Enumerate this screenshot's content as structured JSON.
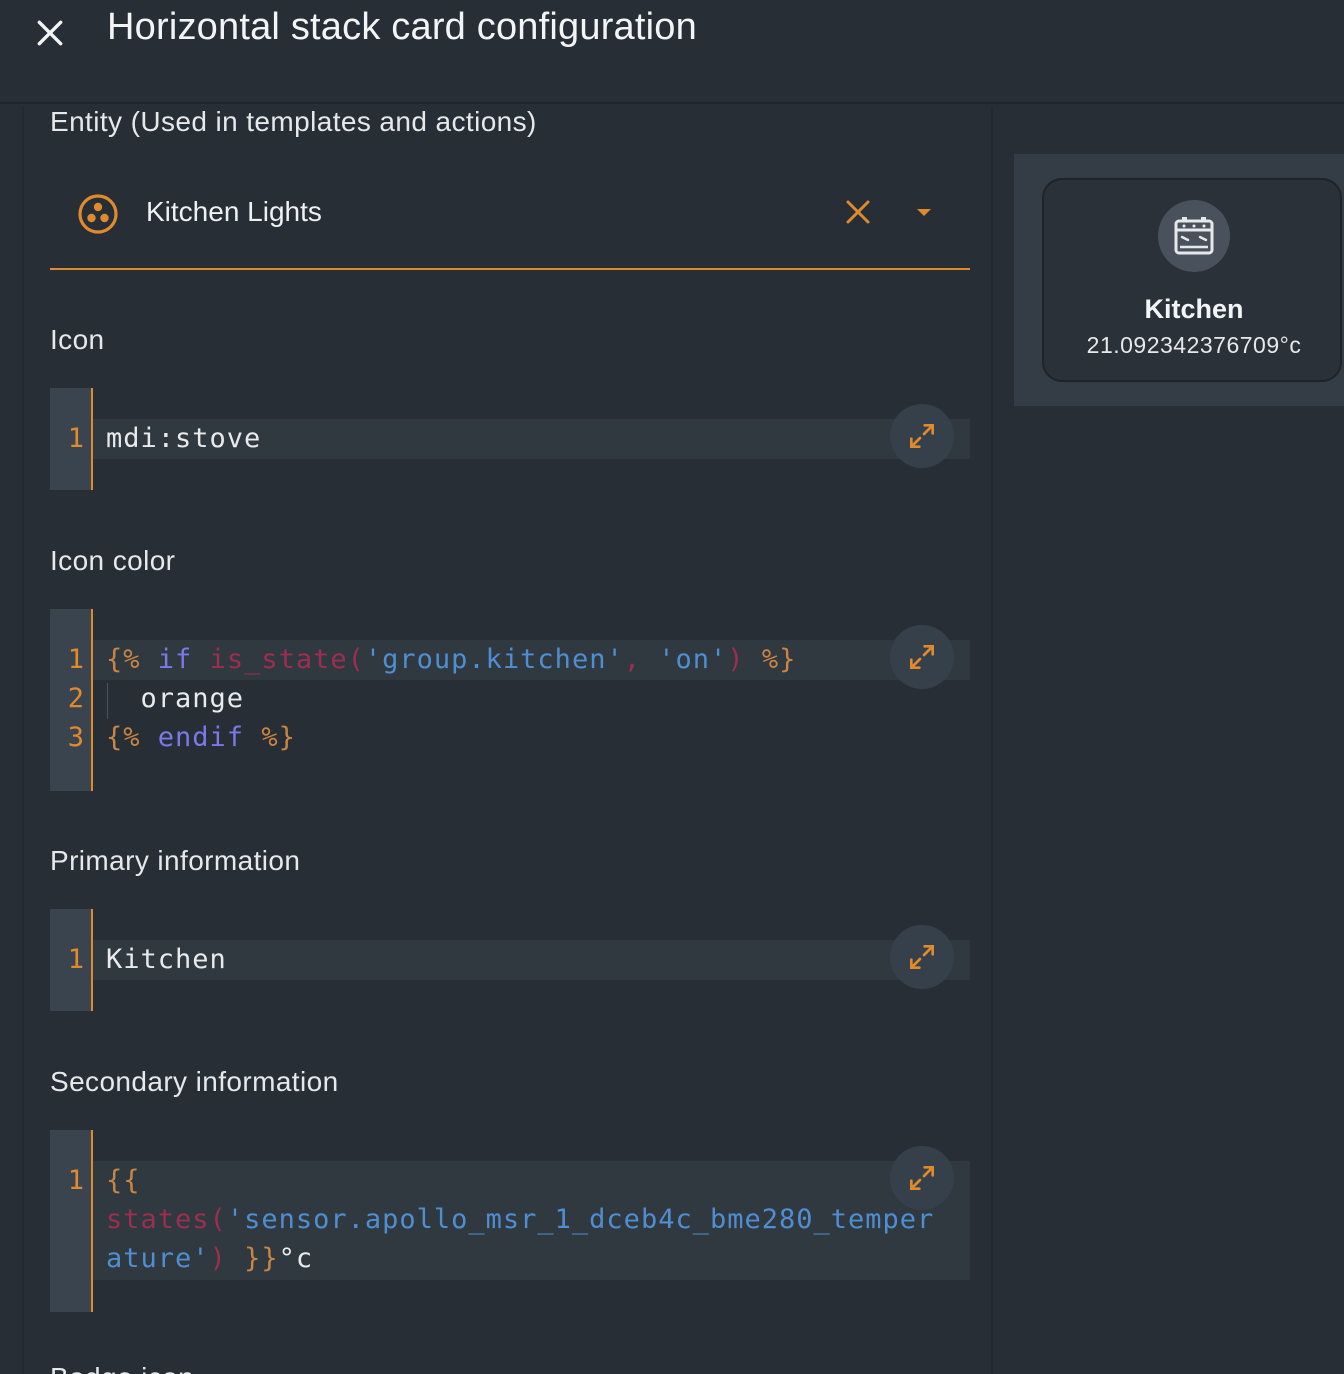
{
  "dialog": {
    "title": "Horizontal stack card configuration",
    "close_icon": "close-icon"
  },
  "entity": {
    "label": "Entity (Used in templates and actions)",
    "value": "Kitchen Lights",
    "icon": "group-icon"
  },
  "icon_field": {
    "label": "Icon",
    "lines": [
      "1"
    ],
    "value": "mdi:stove"
  },
  "icon_color_field": {
    "label": "Icon color",
    "line_numbers": [
      "1",
      "2",
      "3"
    ],
    "line1": {
      "open": "{%",
      "kw": "if",
      "fn": "is_state",
      "paren_open": "(",
      "arg1": "'group.kitchen'",
      "comma": ",",
      "arg2": "'on'",
      "paren_close": ")",
      "close": "%}"
    },
    "line2": "orange",
    "line3": {
      "open": "{%",
      "kw": "endif",
      "close": "%}"
    }
  },
  "primary_field": {
    "label": "Primary information",
    "lines": [
      "1"
    ],
    "value": "Kitchen"
  },
  "secondary_field": {
    "label": "Secondary information",
    "lines": [
      "1"
    ],
    "line1": "{{",
    "line2": {
      "fn": "states",
      "paren_open": "(",
      "str": "'sensor.apollo_msr_1_dceb4c_bme280_temper"
    },
    "line3": {
      "str": "ature'",
      "paren_close": ")",
      "close": "}}",
      "suffix": "°c"
    }
  },
  "next_label": "Badge icon",
  "preview": {
    "icon": "stove-icon",
    "primary": "Kitchen",
    "secondary": "21.092342376709°c"
  },
  "colors": {
    "accent": "#e08a2e",
    "background": "#272e35",
    "gutter": "#3a444e"
  }
}
